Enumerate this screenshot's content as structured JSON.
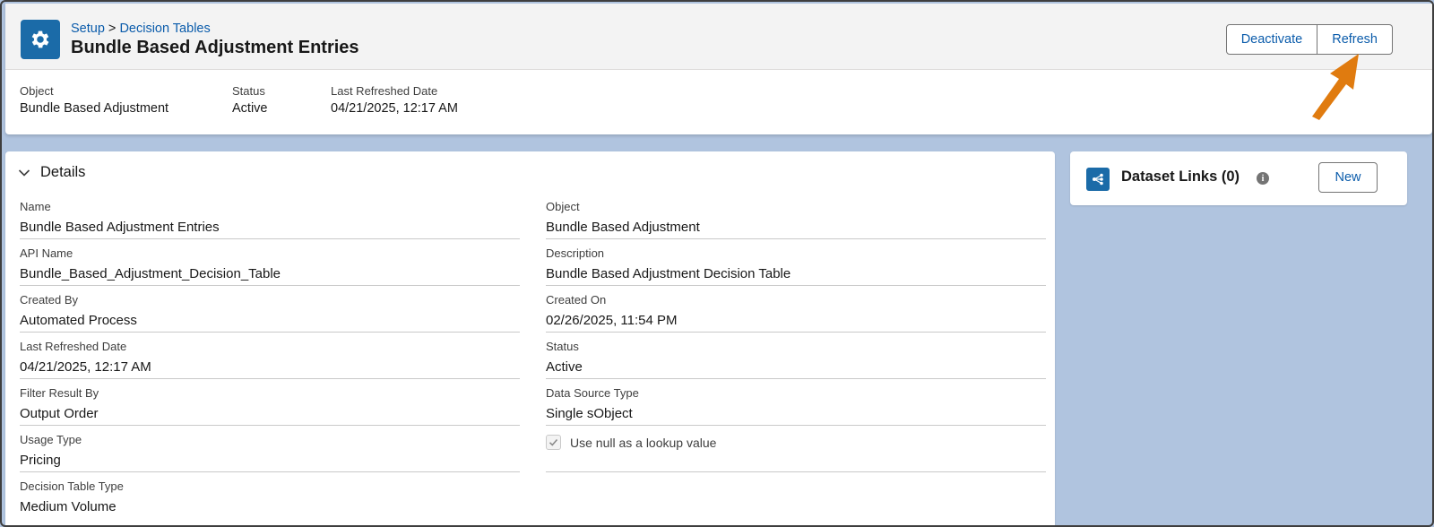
{
  "header": {
    "breadcrumb_root": "Setup",
    "breadcrumb_sep": " > ",
    "breadcrumb_current": "Decision Tables",
    "title": "Bundle Based Adjustment Entries",
    "buttons": {
      "deactivate": "Deactivate",
      "refresh": "Refresh"
    },
    "highlights": [
      {
        "label": "Object",
        "value": "Bundle Based Adjustment"
      },
      {
        "label": "Status",
        "value": "Active"
      },
      {
        "label": "Last Refreshed Date",
        "value": "04/21/2025, 12:17 AM"
      }
    ]
  },
  "details": {
    "section_title": "Details",
    "left_fields": [
      {
        "label": "Name",
        "value": "Bundle Based Adjustment Entries"
      },
      {
        "label": "API Name",
        "value": "Bundle_Based_Adjustment_Decision_Table"
      },
      {
        "label": "Created By",
        "value": "Automated Process"
      },
      {
        "label": "Last Refreshed Date",
        "value": "04/21/2025, 12:17 AM"
      },
      {
        "label": "Filter Result By",
        "value": "Output Order"
      },
      {
        "label": "Usage Type",
        "value": "Pricing"
      },
      {
        "label": "Decision Table Type",
        "value": "Medium Volume"
      }
    ],
    "right_fields": [
      {
        "label": "Object",
        "value": "Bundle Based Adjustment"
      },
      {
        "label": "Description",
        "value": "Bundle Based Adjustment Decision Table"
      },
      {
        "label": "Created On",
        "value": "02/26/2025, 11:54 PM"
      },
      {
        "label": "Status",
        "value": "Active"
      },
      {
        "label": "Data Source Type",
        "value": "Single sObject"
      }
    ],
    "checkbox": {
      "label": "Use null as a lookup value",
      "checked": true
    }
  },
  "dataset_links": {
    "title": "Dataset Links (0)",
    "new_label": "New"
  },
  "colors": {
    "brand": "#1b6ba8",
    "link": "#0b5cab",
    "background": "#b0c4df",
    "annotation_arrow": "#e07b0f"
  }
}
